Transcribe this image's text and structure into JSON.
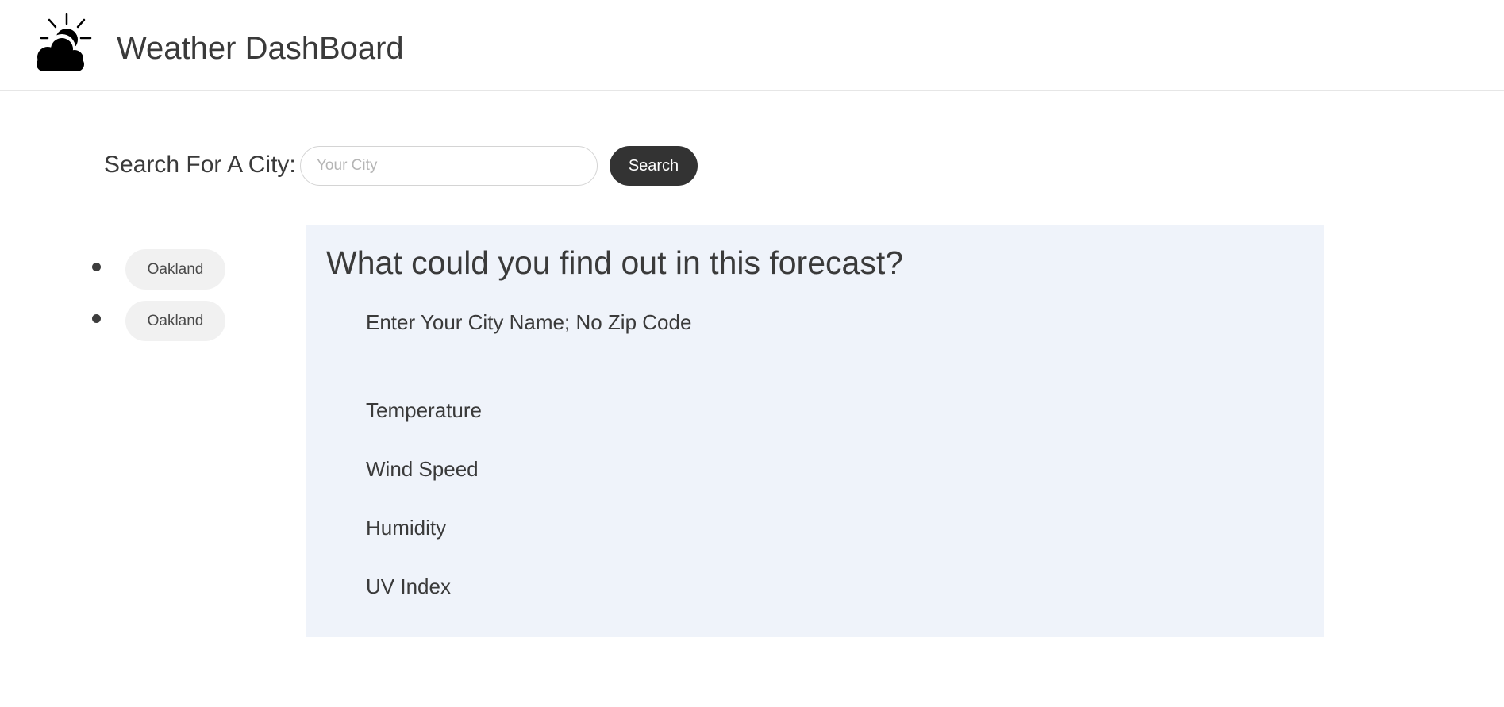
{
  "header": {
    "title": "Weather DashBoard",
    "logo_icon": "sun-behind-cloud-icon"
  },
  "search": {
    "label": "Search For A City:",
    "placeholder": "Your City",
    "value": "",
    "button_label": "Search"
  },
  "history": {
    "items": [
      {
        "label": "Oakland"
      },
      {
        "label": "Oakland"
      }
    ]
  },
  "forecast": {
    "heading": "What could you find out in this forecast?",
    "instruction": "Enter Your City Name; No Zip Code",
    "fields": [
      {
        "label": "Temperature"
      },
      {
        "label": "Wind Speed"
      },
      {
        "label": "Humidity"
      },
      {
        "label": "UV Index"
      }
    ],
    "panel_color": "#eff3fa"
  },
  "colors": {
    "button_dark": "#333333",
    "city_button_bg": "#f1f1f1",
    "text": "#3a3a3a"
  }
}
